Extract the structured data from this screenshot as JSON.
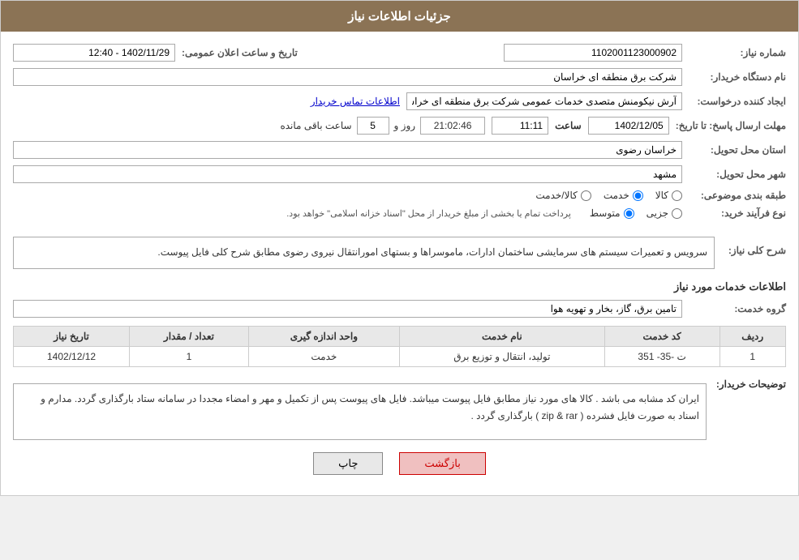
{
  "header": {
    "title": "جزئیات اطلاعات نیاز"
  },
  "form": {
    "need_number_label": "شماره نیاز:",
    "need_number_value": "1102001123000902",
    "buyer_org_label": "نام دستگاه خریدار:",
    "buyer_org_value": "شرکت برق منطقه ای خراسان",
    "creator_label": "ایجاد کننده درخواست:",
    "creator_value": "آرش نیکومنش متصدی خدمات عمومی شرکت برق منطقه ای خراسان",
    "contact_link": "اطلاعات تماس خریدار",
    "response_deadline_label": "مهلت ارسال پاسخ: تا تاریخ:",
    "response_date": "1402/12/05",
    "response_time_label": "ساعت",
    "response_time": "11:11",
    "remaining_days_label": "روز و",
    "remaining_days": "5",
    "remaining_time": "21:02:46",
    "remaining_label": "ساعت باقی مانده",
    "province_label": "استان محل تحویل:",
    "province_value": "خراسان رضوی",
    "city_label": "شهر محل تحویل:",
    "city_value": "مشهد",
    "category_label": "طبقه بندی موضوعی:",
    "category_options": [
      {
        "label": "کالا",
        "value": "kala"
      },
      {
        "label": "خدمت",
        "value": "khedmat"
      },
      {
        "label": "کالا/خدمت",
        "value": "kala_khedmat"
      }
    ],
    "category_selected": "khedmat",
    "process_type_label": "نوع فرآیند خرید:",
    "process_options": [
      {
        "label": "جزیی",
        "value": "jozei"
      },
      {
        "label": "متوسط",
        "value": "motavasset"
      }
    ],
    "process_note": "پرداخت تمام یا بخشی از مبلغ خریدار از محل \"اسناد خزانه اسلامی\" خواهد بود.",
    "announce_date_label": "تاریخ و ساعت اعلان عمومی:",
    "announce_date_value": "1402/11/29 - 12:40",
    "description_label": "شرح کلی نیاز:",
    "description_value": "سرویس و تعمیرات سیستم های سرمایشی ساختمان ادارات، ماموسراها و  بستهای امورانتقال نیروی رضوی مطابق شرح کلی فایل پیوست.",
    "service_info_title": "اطلاعات خدمات مورد نیاز",
    "service_group_label": "گروه خدمت:",
    "service_group_value": "تامین برق، گاز، بخار و تهویه هوا",
    "table": {
      "columns": [
        "ردیف",
        "کد خدمت",
        "نام خدمت",
        "واحد اندازه گیری",
        "تعداد / مقدار",
        "تاریخ نیاز"
      ],
      "rows": [
        {
          "row_num": "1",
          "service_code": "ت -35- 351",
          "service_name": "تولید، انتقال و توزیع برق",
          "unit": "خدمت",
          "quantity": "1",
          "date": "1402/12/12"
        }
      ]
    },
    "buyer_notes_label": "توضیحات خریدار:",
    "buyer_notes_value": "ایران کد مشابه می باشد . کالا های مورد نیاز مطابق فایل پیوست میباشد. فایل های پیوست پس از تکمیل و مهر و امضاء مجددا در سامانه ستاد بارگذاری گردد. مدارم و اسناد به صورت فایل فشرده ( zip & rar ) بارگذاری گردد .",
    "btn_back": "بازگشت",
    "btn_print": "چاپ"
  }
}
